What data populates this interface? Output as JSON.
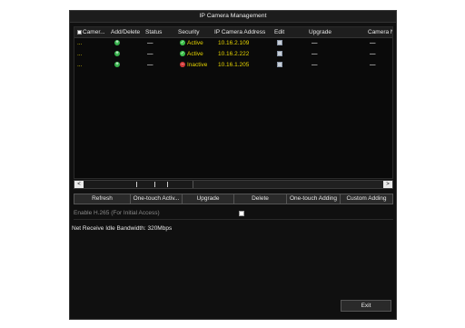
{
  "window": {
    "title": "IP Camera Management"
  },
  "table": {
    "columns": [
      "Camer...",
      "Add/Delete",
      "Status",
      "Security",
      "IP Camera Address",
      "Edit",
      "Upgrade",
      "Camera Na"
    ],
    "rows": [
      {
        "camera": "...",
        "status": "—",
        "security": "Active",
        "security_state": "active",
        "address": "10.16.2.109",
        "upgrade": "—",
        "camera_name": "—"
      },
      {
        "camera": "...",
        "status": "—",
        "security": "Active",
        "security_state": "active",
        "address": "10.16.2.222",
        "upgrade": "—",
        "camera_name": "—"
      },
      {
        "camera": "...",
        "status": "—",
        "security": "Inactive",
        "security_state": "inactive",
        "address": "10.16.1.205",
        "upgrade": "—",
        "camera_name": "—"
      }
    ]
  },
  "scrollbar": {
    "left_arrow": "<",
    "right_arrow": ">"
  },
  "buttons": {
    "refresh": "Refresh",
    "one_touch_activate": "One-touch Activ...",
    "upgrade": "Upgrade",
    "delete": "Delete",
    "one_touch_adding": "One-touch Adding",
    "custom_adding": "Custom Adding"
  },
  "h265": {
    "label": "Enable H.265 (For Initial Access)",
    "checked": false
  },
  "bandwidth": {
    "text": "Net Receive Idle Bandwidth: 320Mbps"
  },
  "exit": {
    "label": "Exit"
  },
  "icons": {
    "add": "add-circle-icon",
    "status_ok": "green-check-icon",
    "status_bad": "red-minus-icon",
    "edit": "edit-icon"
  },
  "colors": {
    "background": "#101010",
    "highlight": "#e5d300",
    "active": "#3cbf4a",
    "inactive": "#d23a3a"
  }
}
